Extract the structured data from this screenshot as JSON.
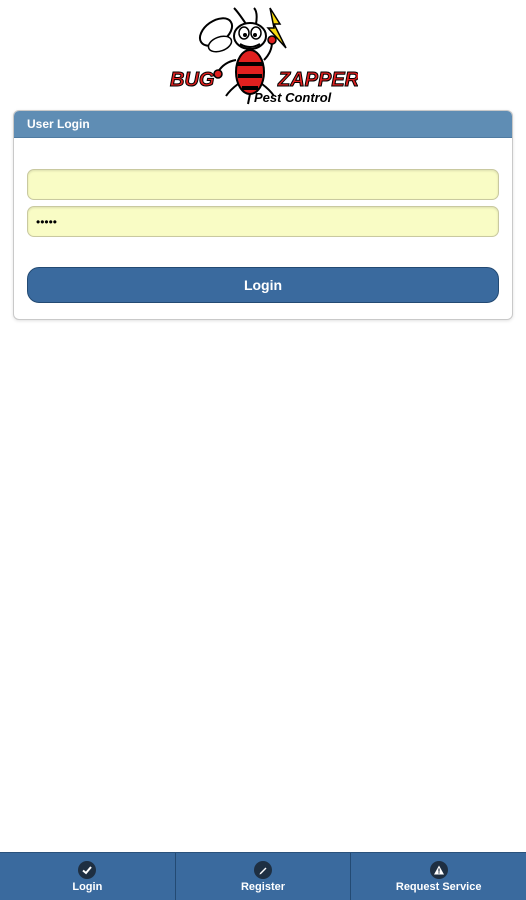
{
  "logo": {
    "name_top": "BUG",
    "name_right": "ZAPPERS",
    "tagline": "Pest Control",
    "icon": "bee-mascot-icon",
    "colors": {
      "red": "#e0201f",
      "yellow": "#f6d90f",
      "black": "#000000"
    }
  },
  "login_card": {
    "title": "User Login",
    "username": {
      "value": "",
      "placeholder": ""
    },
    "password": {
      "value": "•••••",
      "placeholder": ""
    },
    "submit_label": "Login"
  },
  "bottom_nav": {
    "items": [
      {
        "label": "Login",
        "icon": "checkmark-icon"
      },
      {
        "label": "Register",
        "icon": "pencil-icon"
      },
      {
        "label": "Request Service",
        "icon": "warning-icon"
      }
    ]
  },
  "colors": {
    "header_bar": "#5f8db4",
    "button": "#3a6a9e",
    "input_bg": "#f9fcc5"
  }
}
